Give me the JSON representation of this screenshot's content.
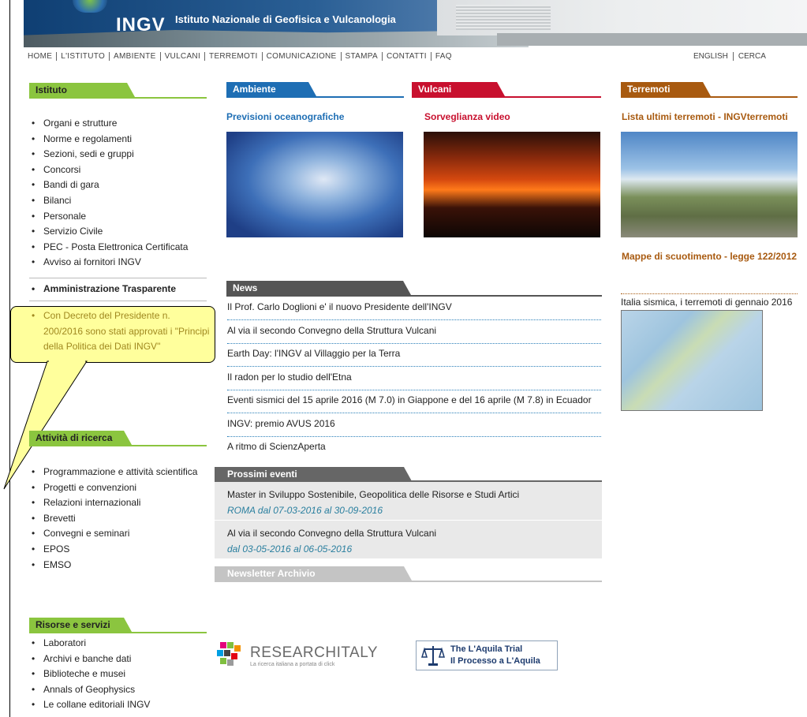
{
  "header": {
    "logo_text": "INGV",
    "title": "Istituto Nazionale di Geofisica e Vulcanologia"
  },
  "top_nav": [
    "HOME",
    "L'ISTITUTO",
    "AMBIENTE",
    "VULCANI",
    "TERREMOTI",
    "COMUNICAZIONE",
    "STAMPA",
    "CONTATTI",
    "FAQ"
  ],
  "right_nav": [
    "ENGLISH",
    "CERCA"
  ],
  "colors": {
    "istituto_green": "#8bc53f",
    "ambiente_blue": "#1e6eb4",
    "vulcani_red": "#c8102e",
    "terremoti_orange": "#a85a10",
    "news_grey": "#555555",
    "callout_yellow": "#ffff9c"
  },
  "istituto": {
    "title": "Istituto",
    "items": [
      "Organi e strutture",
      "Norme e regolamenti",
      "Sezioni, sedi e gruppi",
      "Concorsi",
      "Bandi di gara",
      "Bilanci",
      "Personale",
      "Servizio Civile",
      "PEC - Posta Elettronica Certificata",
      "Avviso ai fornitori INGV"
    ],
    "trasparente": "Amministrazione Trasparente",
    "highlight": "Con Decreto del Presidente n. 200/2016 sono stati approvati i \"Principi della Politica dei Dati INGV\""
  },
  "ricerca": {
    "title": "Attività di ricerca",
    "items": [
      "Programmazione e attività scientifica",
      "Progetti e convenzioni",
      "Relazioni internazionali",
      "Brevetti",
      "Convegni e seminari",
      "EPOS",
      "EMSO"
    ]
  },
  "risorse": {
    "title": "Risorse e servizi",
    "items": [
      "Laboratori",
      "Archivi e banche dati",
      "Biblioteche e musei",
      "Annals of Geophysics",
      "Le collane editoriali INGV"
    ]
  },
  "ambiente": {
    "tab": "Ambiente",
    "link": "Previsioni oceanografiche"
  },
  "vulcani": {
    "tab": "Vulcani",
    "link": "Sorveglianza video"
  },
  "terremoti": {
    "tab": "Terremoti",
    "link1": "Lista ultimi terremoti - INGVterremoti",
    "link2": "Mappe di scuotimento - legge 122/2012",
    "map_caption": "Italia sismica, i terremoti di gennaio 2016"
  },
  "news": {
    "tab": "News",
    "items": [
      "Il Prof. Carlo Doglioni e' il nuovo Presidente dell'INGV",
      "Al via il secondo Convegno della Struttura Vulcani",
      "Earth Day: l'INGV al Villaggio per la Terra",
      "Il radon per lo studio dell'Etna",
      "Eventi sismici del 15 aprile 2016 (M 7.0) in Giappone e del 16 aprile (M 7.8) in Ecuador",
      "INGV: premio AVUS 2016",
      "A ritmo di ScienzAperta"
    ]
  },
  "events": {
    "tab": "Prossimi eventi",
    "items": [
      {
        "title": "Master in Sviluppo Sostenibile, Geopolitica delle Risorse e Studi Artici",
        "date": "ROMA dal 07-03-2016 al 30-09-2016"
      },
      {
        "title": "Al via il secondo Convegno della Struttura Vulcani",
        "date": "dal 03-05-2016 al 06-05-2016"
      }
    ]
  },
  "newsletter": {
    "tab": "Newsletter Archivio"
  },
  "banners": {
    "researchitaly": "RESEARCHITALY",
    "researchitaly_sub": "La ricerca italiana a portata di click",
    "aquila_line1": "The L'Aquila Trial",
    "aquila_line2": "Il Processo a L'Aquila"
  }
}
